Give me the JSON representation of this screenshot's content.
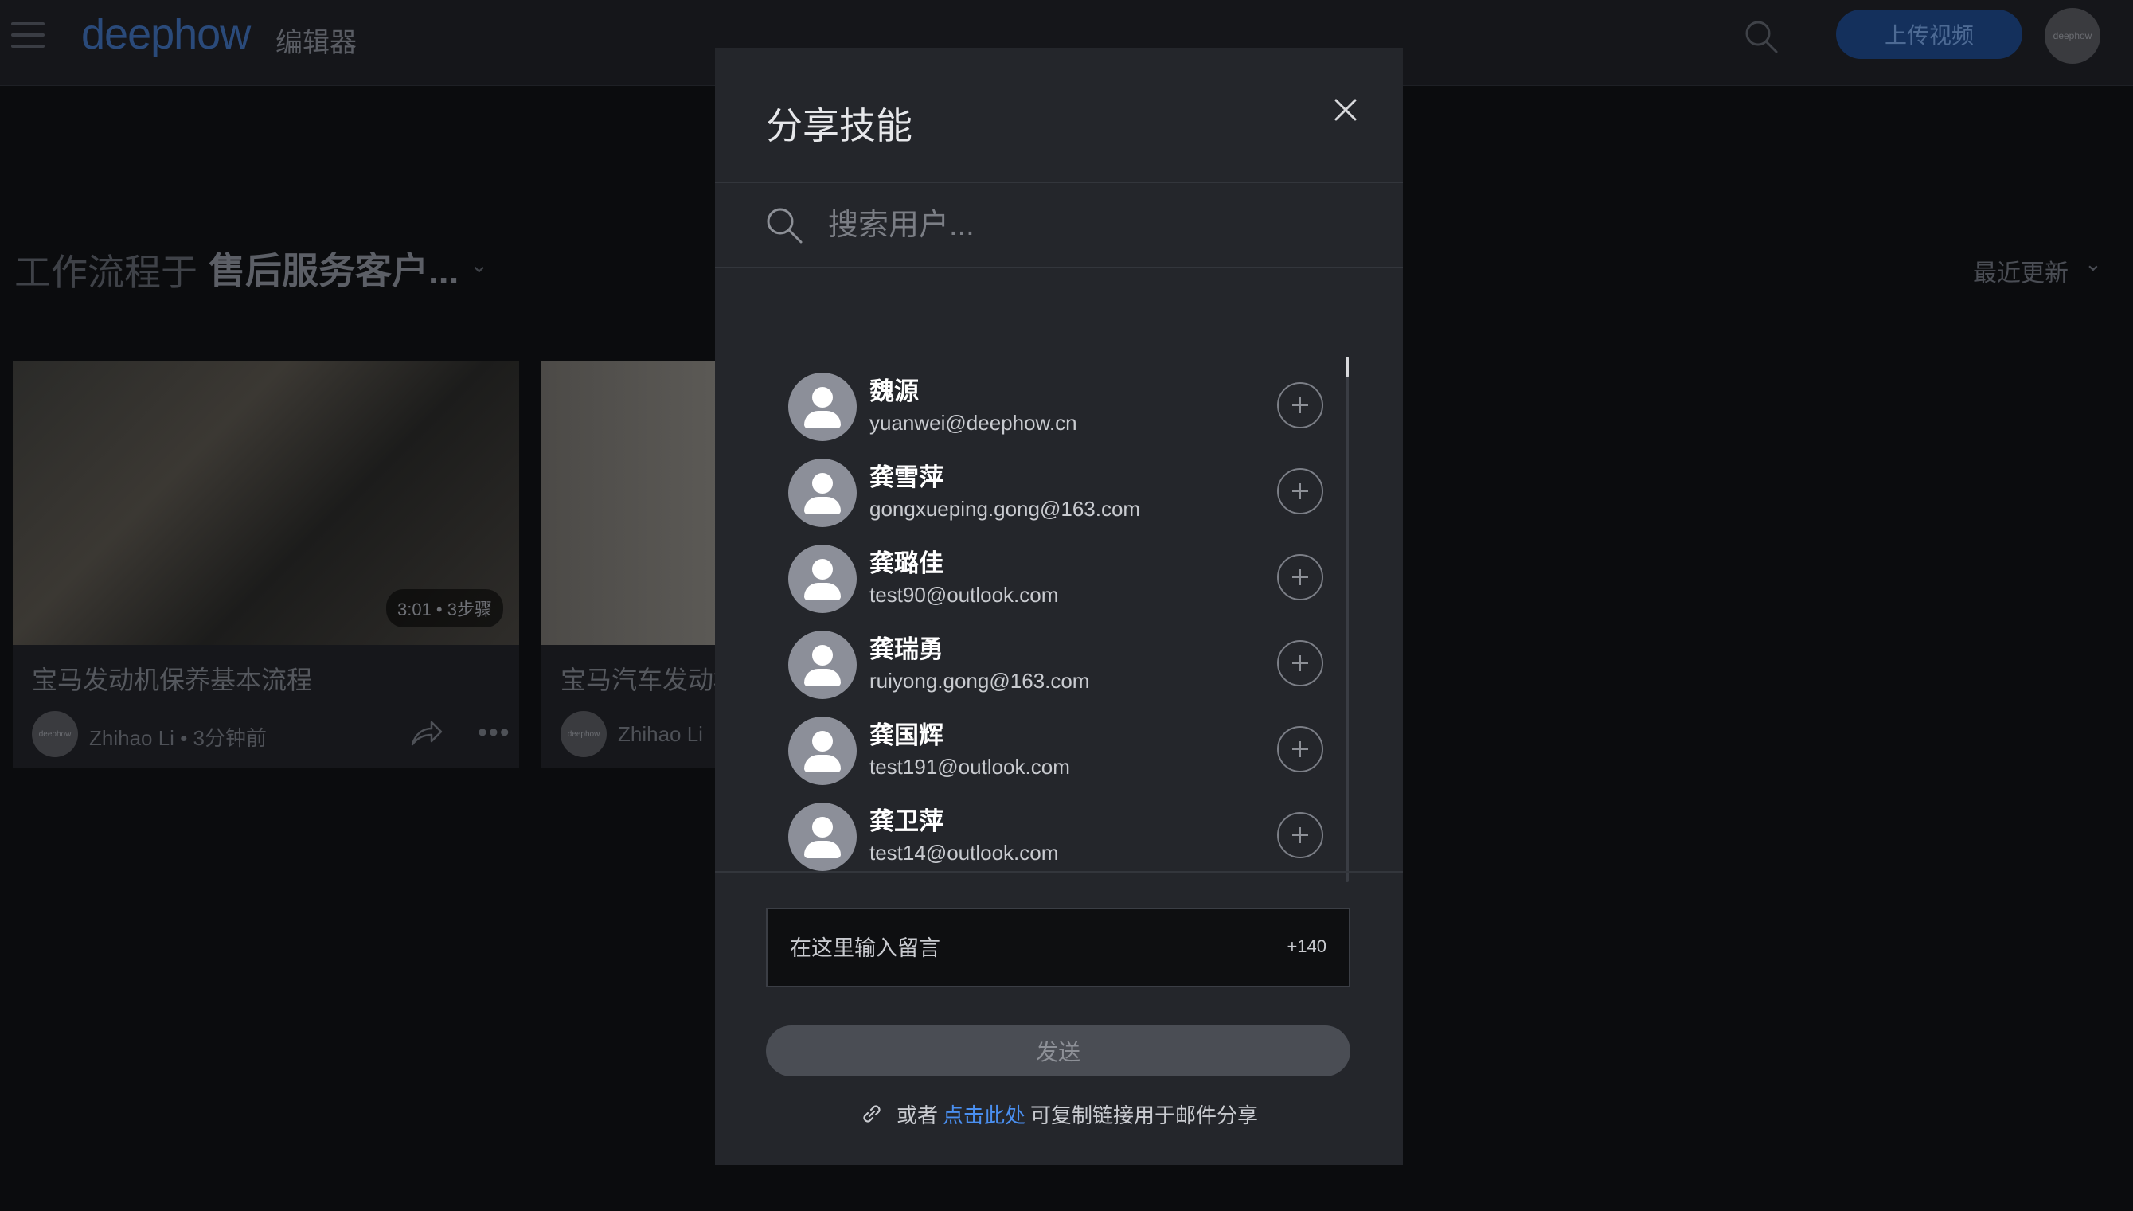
{
  "app": {
    "logo_text": "deephow",
    "editor_label": "编辑器",
    "upload_label": "上传视频",
    "avatar_text": "deephow"
  },
  "toolbar": {
    "workflow_prefix": "工作流程于",
    "workflow_name": "售后服务客户...",
    "sort_label": "最近更新"
  },
  "cards": [
    {
      "title": "宝马发动机保养基本流程",
      "duration": "3:01",
      "steps": "3步骤",
      "author": "Zhihao Li",
      "time": "3分钟前",
      "avatar_text": "deephow"
    },
    {
      "title": "宝马汽车发动机",
      "author": "Zhihao Li",
      "avatar_text": "deephow"
    }
  ],
  "modal": {
    "title": "分享技能",
    "search_placeholder": "搜索用户...",
    "users": [
      {
        "name": "魏源",
        "email": "yuanwei@deephow.cn"
      },
      {
        "name": "龚雪萍",
        "email": "gongxueping.gong@163.com"
      },
      {
        "name": "龚璐佳",
        "email": "test90@outlook.com"
      },
      {
        "name": "龚瑞勇",
        "email": "ruiyong.gong@163.com"
      },
      {
        "name": "龚国辉",
        "email": "test191@outlook.com"
      },
      {
        "name": "龚卫萍",
        "email": "test14@outlook.com"
      }
    ],
    "message_placeholder": "在这里输入留言",
    "char_count": "+140",
    "send_label": "发送",
    "copy_prefix": "或者",
    "copy_link": "点击此处",
    "copy_suffix": "可复制链接用于邮件分享",
    "accent_color": "#4a8ff0"
  }
}
